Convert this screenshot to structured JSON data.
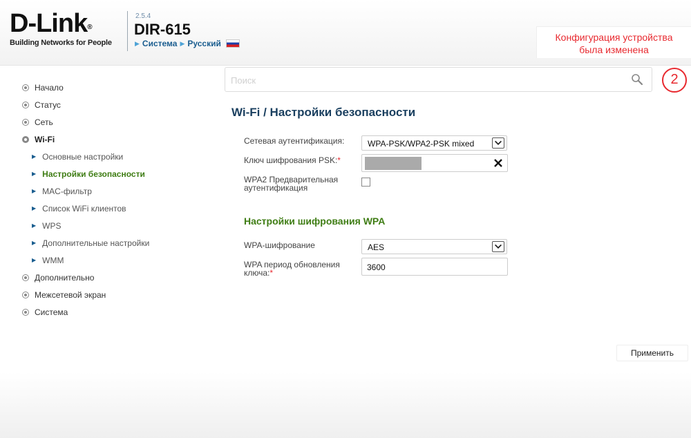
{
  "header": {
    "logo_text": "D-Link",
    "logo_tagline": "Building Networks for People",
    "firmware_version": "2.5.4",
    "model": "DIR-615",
    "breadcrumb": [
      "Система",
      "Русский"
    ],
    "config_notice_line1": "Конфигурация устройства",
    "config_notice_line2": "была изменена"
  },
  "search": {
    "placeholder": "Поиск"
  },
  "notifications": {
    "count": "2"
  },
  "sidebar": {
    "items": [
      {
        "label": "Начало"
      },
      {
        "label": "Статус"
      },
      {
        "label": "Сеть"
      },
      {
        "label": "Wi-Fi"
      },
      {
        "label": "Дополнительно"
      },
      {
        "label": "Межсетевой экран"
      },
      {
        "label": "Система"
      }
    ],
    "wifi_subitems": [
      {
        "label": "Основные настройки"
      },
      {
        "label": "Настройки безопасности"
      },
      {
        "label": "MAC-фильтр"
      },
      {
        "label": "Список WiFi клиентов"
      },
      {
        "label": "WPS"
      },
      {
        "label": "Дополнительные настройки"
      },
      {
        "label": "WMM"
      }
    ]
  },
  "main": {
    "title": "Wi-Fi /  Настройки безопасности",
    "auth_label": "Сетевая аутентификация:",
    "auth_value": "WPA-PSK/WPA2-PSK mixed",
    "psk_label": "Ключ шифрования PSK:",
    "req_mark": "*",
    "preauth_label_line1": "WPA2 Предварительная",
    "preauth_label_line2": "аутентификация",
    "wpa_section_title": "Настройки шифрования WPA",
    "wpa_cipher_label": "WPA-шифрование",
    "wpa_cipher_value": "AES",
    "wpa_rekey_label_line1": "WPA период обновления",
    "wpa_rekey_label_line2": "ключа:",
    "wpa_rekey_value": "3600",
    "apply_label": "Применить"
  },
  "colors": {
    "accent_blue": "#1a5d8f",
    "accent_green": "#3f7d14",
    "alert_red": "#e8292f"
  }
}
